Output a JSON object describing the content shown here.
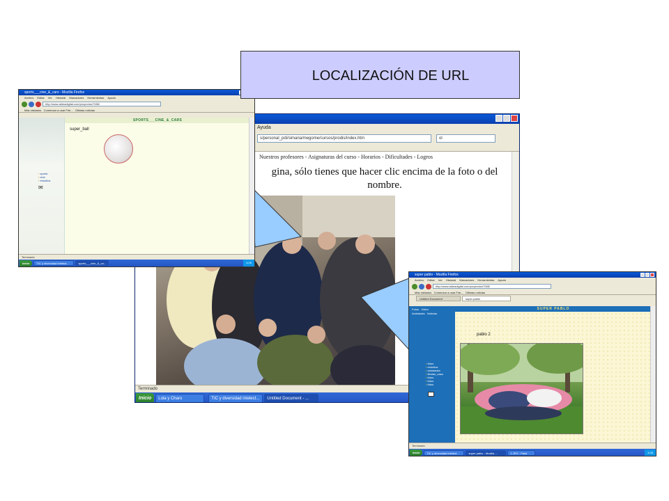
{
  "callout": {
    "text": "LOCALIZACIÓN DE URL"
  },
  "main_window": {
    "menu": [
      "Ayuda"
    ],
    "url": "s/personal_pdi/simaria/megome/cursos/prodis/index.htm",
    "search_placeholder": "ol",
    "nav_links": "Nuestros profesores  -  Asignaturas del curso  -  Horarios  -  Dificultades  -  Logros",
    "message": "gina, sólo tienes que hacer clic encima de la foto o del nombre.",
    "status": "Terminado",
    "taskbar": {
      "start": "Inicio",
      "items": [
        "Lola y Charo",
        "TIC y diversidad intelect...",
        "Untitled Document - ..."
      ]
    }
  },
  "sports_window": {
    "title": "sports___cine_&_cars - Mozilla Firefox",
    "menu": [
      "Archivo",
      "Editar",
      "Ver",
      "Historial",
      "Marcadores",
      "Herramientas",
      "Ayuda"
    ],
    "url": "http://www.aldeadigital.com/proyectos/7086/",
    "bookmarks": [
      "Más visitados",
      "Comenzar a usar Fire...",
      "Últimas noticias"
    ],
    "header": "SPORTS___CINE_&_CARS",
    "item_label": "super_ball",
    "links": [
      "sports",
      "cine",
      "estudios"
    ],
    "status": "Terminado",
    "taskbar": {
      "start": "Inicio",
      "items": [
        "TIC y diversidad intelect...",
        "sports___cine_&_ca..."
      ],
      "clock": "4:05"
    }
  },
  "pablo_window": {
    "title": "super pablo - Mozilla Firefox",
    "menu": [
      "Archivo",
      "Editar",
      "Ver",
      "Historial",
      "Marcadores",
      "Herramientas",
      "Ayuda"
    ],
    "url": "http://www.aldeadigital.com/proyectos/7085/",
    "bookmarks": [
      "Más visitados",
      "Comenzar a usar Fire...",
      "Últimas noticias"
    ],
    "tabs": [
      "Untitled Document",
      "super pablo"
    ],
    "header": "SUPER PABLO",
    "sidebar_top": [
      "Fotos",
      "Vídeo",
      "Amistades",
      "Noticias"
    ],
    "item_label": "pablo 2",
    "links": [
      "fotos",
      "estudios",
      "amistades",
      "fiestas_casa",
      "fotos",
      "fotos",
      "fotos"
    ],
    "status": "Terminado",
    "taskbar": {
      "start": "Inicio",
      "items": [
        "TIC y diversidad intelect...",
        "super pablo - Mozilla ...",
        "1.JPG - Paint"
      ],
      "clock": "4:06"
    }
  }
}
